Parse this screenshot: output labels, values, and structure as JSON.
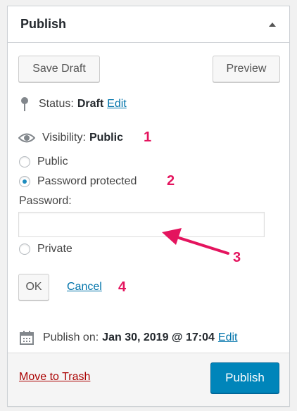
{
  "header": {
    "title": "Publish"
  },
  "actions": {
    "save_draft": "Save Draft",
    "preview": "Preview"
  },
  "status": {
    "label": "Status:",
    "value": "Draft",
    "edit": "Edit"
  },
  "visibility": {
    "label": "Visibility:",
    "value": "Public",
    "options": [
      {
        "label": "Public",
        "checked": false
      },
      {
        "label": "Password protected",
        "checked": true
      },
      {
        "label": "Private",
        "checked": false
      }
    ],
    "password_label": "Password:",
    "password_value": "",
    "ok": "OK",
    "cancel": "Cancel"
  },
  "schedule": {
    "label": "Publish on:",
    "value": "Jan 30, 2019 @ 17:04",
    "edit": "Edit"
  },
  "footer": {
    "trash": "Move to Trash",
    "publish": "Publish"
  },
  "annotations": {
    "a1": "1",
    "a2": "2",
    "a3": "3",
    "a4": "4"
  },
  "colors": {
    "accent": "#0085ba",
    "link": "#0073aa",
    "annotation": "#e4145e",
    "danger": "#a00"
  }
}
